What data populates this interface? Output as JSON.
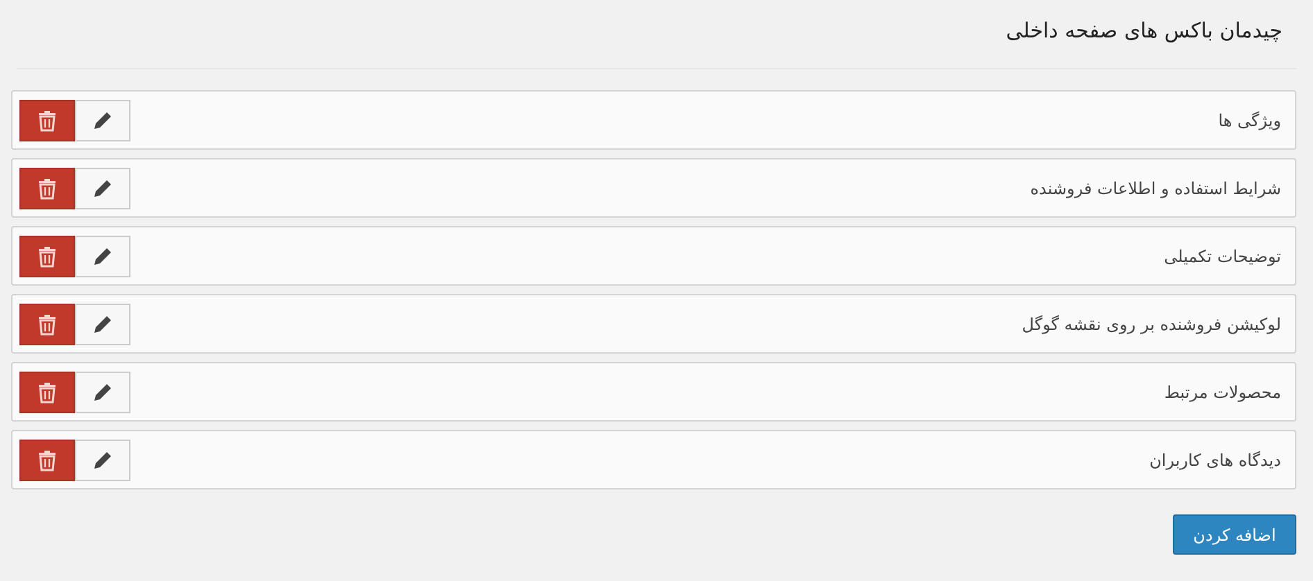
{
  "title": "چیدمان باکس های صفحه داخلی",
  "boxes": [
    {
      "label": "ویژگی ها"
    },
    {
      "label": "شرایط استفاده و اطلاعات فروشنده"
    },
    {
      "label": "توضیحات تکمیلی"
    },
    {
      "label": "لوکیشن فروشنده بر روی نقشه گوگل"
    },
    {
      "label": "محصولات مرتبط"
    },
    {
      "label": "دیدگاه های کاربران"
    }
  ],
  "add_button": "اضافه کردن"
}
